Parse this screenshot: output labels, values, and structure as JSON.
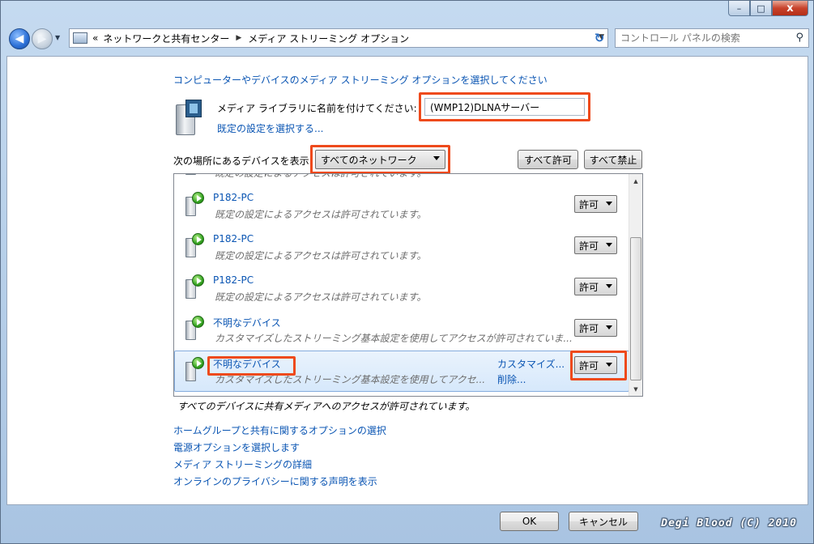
{
  "window": {
    "minimize_glyph": "–",
    "maximize_glyph": "□",
    "close_glyph": "x"
  },
  "toolbar": {
    "back_glyph": "◀",
    "forward_glyph": "▶",
    "history_dropdown_glyph": "▼",
    "breadcrumb_prefix": "«",
    "breadcrumbs": [
      "ネットワークと共有センター",
      "メディア ストリーミング オプション"
    ],
    "breadcrumb_separator": "▶",
    "address_dropdown_glyph": "▼",
    "refresh_glyph": "↻",
    "search_placeholder": "コントロール パネルの検索",
    "search_glyph": "⚲"
  },
  "main": {
    "heading": "コンピューターやデバイスのメディア ストリーミング オプションを選択してください",
    "library_name_label": "メディア ライブラリに名前を付けてください:",
    "library_name_value": "(WMP12)DLNAサーバー",
    "default_settings_link": "既定の設定を選択する...",
    "show_devices_label": "次の場所にあるデバイスを表示:",
    "network_select_value": "すべてのネットワーク",
    "allow_all_button": "すべて許可",
    "block_all_button": "すべて禁止"
  },
  "device_list": {
    "scroll_up_glyph": "▲",
    "scroll_down_glyph": "▼",
    "partial_top_desc": "既定の設定によるアクセスは許可されています。",
    "rows": [
      {
        "name": "P182-PC",
        "desc": "既定の設定によるアクセスは許可されています。",
        "access": "許可"
      },
      {
        "name": "P182-PC",
        "desc": "既定の設定によるアクセスは許可されています。",
        "access": "許可"
      },
      {
        "name": "P182-PC",
        "desc": "既定の設定によるアクセスは許可されています。",
        "access": "許可"
      },
      {
        "name": "不明なデバイス",
        "desc": "カスタマイズしたストリーミング基本設定を使用してアクセスが許可されていま...",
        "access": "許可"
      },
      {
        "name": "不明なデバイス",
        "desc": "カスタマイズしたストリーミング基本設定を使用してアクセ...",
        "access": "許可",
        "customize_link": "カスタマイズ...",
        "remove_link": "削除..."
      }
    ]
  },
  "status_text": "すべてのデバイスに共有メディアへのアクセスが許可されています。",
  "footer_links": [
    "ホームグループと共有に関するオプションの選択",
    "電源オプションを選択します",
    "メディア ストリーミングの詳細",
    "オンラインのプライバシーに関する声明を表示"
  ],
  "dialog_buttons": {
    "ok": "OK",
    "cancel": "キャンセル"
  },
  "watermark": "Degi Blood (C) 2010",
  "colors": {
    "link": "#0a55b3",
    "highlight": "#ee4a1c",
    "selected_row": "#d6e8fb"
  }
}
